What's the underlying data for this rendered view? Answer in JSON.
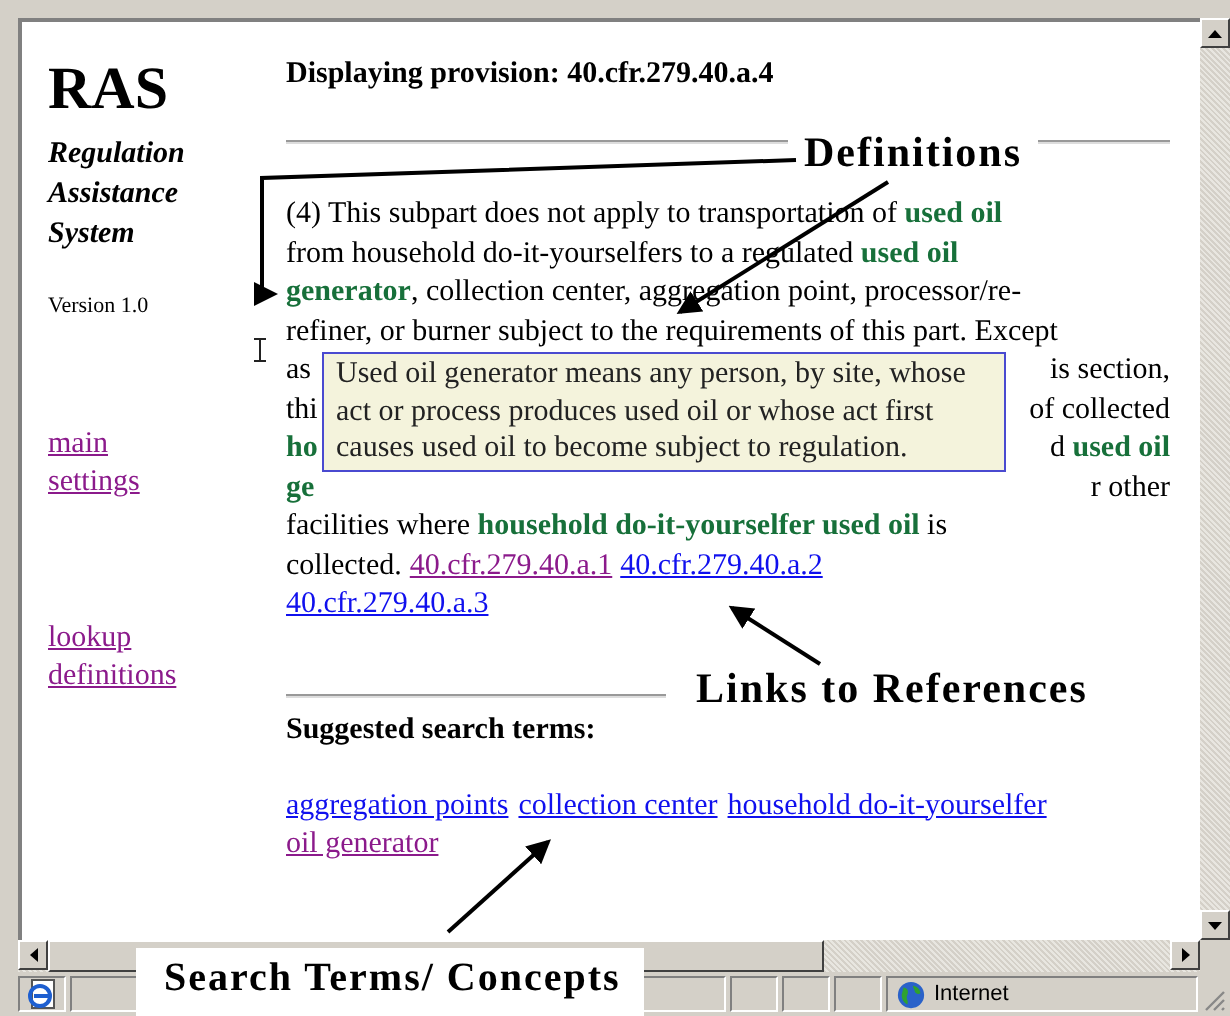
{
  "sidebar": {
    "logo": "RAS",
    "subtitle": [
      "Regulation",
      "Assistance",
      "System"
    ],
    "version": "Version 1.0",
    "link_groups": [
      [
        {
          "label": "main",
          "visited": true
        },
        {
          "label": "settings",
          "visited": true
        }
      ],
      [
        {
          "label": "lookup",
          "visited": true
        },
        {
          "label": "definitions",
          "visited": true
        }
      ]
    ]
  },
  "heading": "Displaying provision: 40.cfr.279.40.a.4",
  "paragraph_lines": [
    {
      "left": "(4) This subpart does not apply to transportation of **used oil**"
    },
    {
      "left": "from household do-it-yourselfers to a regulated **used oil**"
    },
    {
      "left": "**generator**, collection center, aggregation point, processor/re-"
    },
    {
      "left": "refiner, or burner subject to the requirements of this part. Except"
    },
    {
      "left": "as",
      "right": "is section,"
    },
    {
      "left": "thi",
      "right": "of collected"
    },
    {
      "left": "**ho**",
      "right": "d **used oil**"
    },
    {
      "left": "**ge**",
      "right": "r other"
    },
    {
      "left": "facilities where **household do-it-yourselfer used oil** is"
    },
    {
      "left": "collected."
    }
  ],
  "references": [
    {
      "label": "40.cfr.279.40.a.1",
      "visited": true
    },
    {
      "label": "40.cfr.279.40.a.2",
      "visited": false
    },
    {
      "label": "40.cfr.279.40.a.3",
      "visited": false
    }
  ],
  "tooltip": "Used oil generator means any person, by site, whose act or process produces used oil or whose act first causes used oil to become subject to regulation.",
  "suggested_heading": "Suggested search terms:",
  "search_terms": [
    {
      "label": "aggregation points",
      "visited": false
    },
    {
      "label": "collection center",
      "visited": false
    },
    {
      "label": "household do-it-yourselfer",
      "visited": false
    },
    {
      "label": "oil generator",
      "visited": true
    }
  ],
  "annotations": {
    "definitions": "Definitions",
    "references": "Links to References",
    "search_terms": "Search Terms/ Concepts"
  },
  "status_bar": {
    "zone": "Internet"
  }
}
